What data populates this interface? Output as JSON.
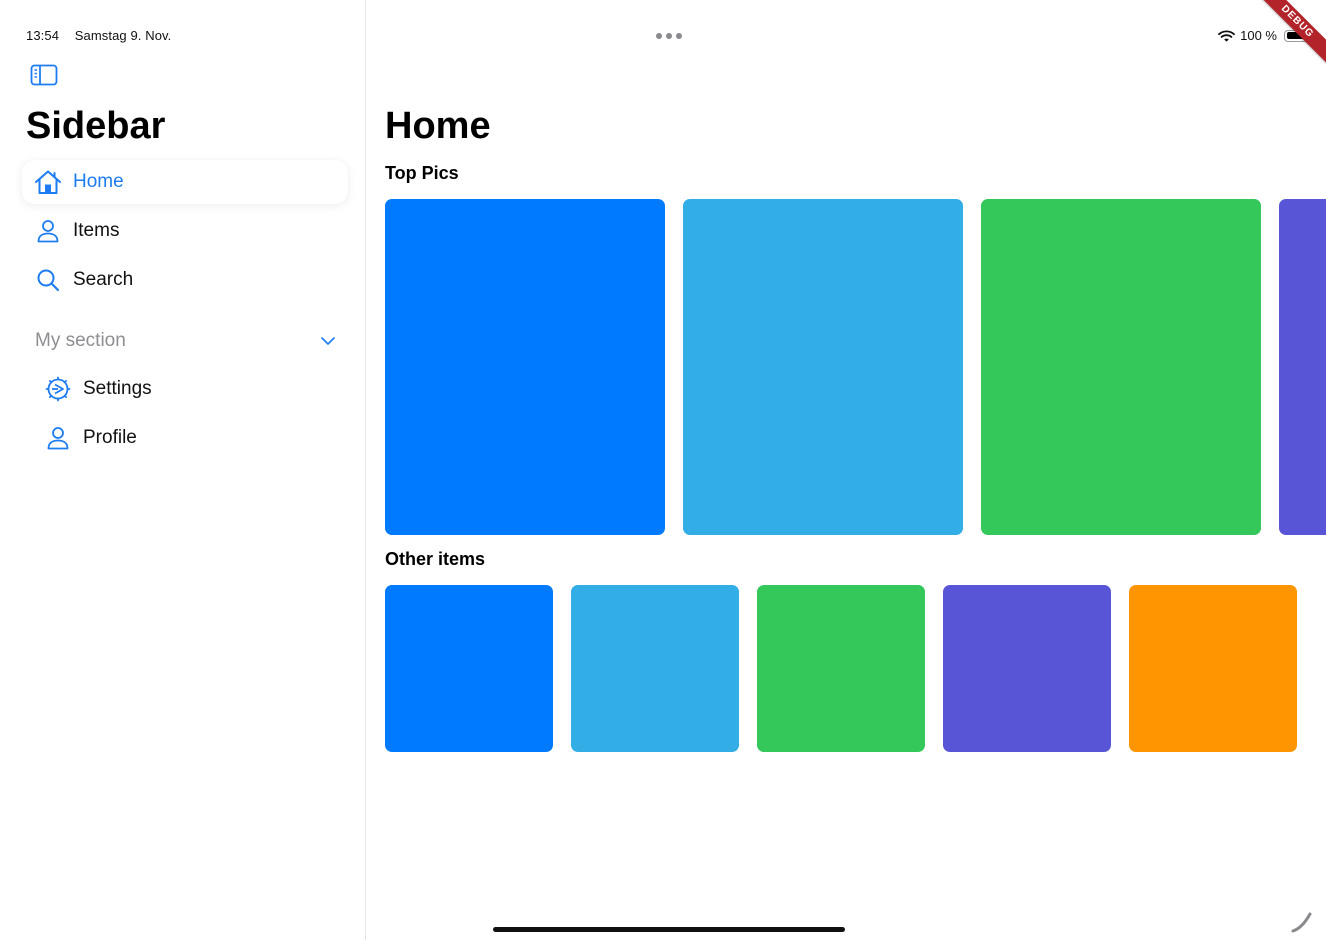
{
  "status_bar": {
    "time": "13:54",
    "date": "Samstag 9. Nov.",
    "battery_text": "100 %"
  },
  "debug_banner": "DEBUG",
  "sidebar": {
    "title": "Sidebar",
    "items": [
      {
        "label": "Home",
        "icon": "home-icon",
        "active": true
      },
      {
        "label": "Items",
        "icon": "person-icon",
        "active": false
      },
      {
        "label": "Search",
        "icon": "search-icon",
        "active": false
      }
    ],
    "section": {
      "label": "My section",
      "expanded": true,
      "items": [
        {
          "label": "Settings",
          "icon": "gear-icon"
        },
        {
          "label": "Profile",
          "icon": "person-icon"
        }
      ]
    }
  },
  "main": {
    "title": "Home",
    "top_pics": {
      "title": "Top Pics",
      "colors": [
        "#007AFF",
        "#32ADE6",
        "#34C759",
        "#5856D6"
      ]
    },
    "other_items": {
      "title": "Other items",
      "colors": [
        "#007AFF",
        "#32ADE6",
        "#34C759",
        "#5856D6",
        "#FF9500"
      ]
    }
  },
  "colors": {
    "accent": "#1e7cf2",
    "secondary_text": "#8e8e93"
  }
}
